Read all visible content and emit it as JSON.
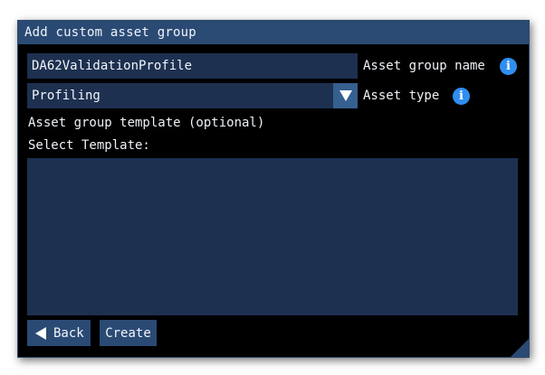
{
  "dialog": {
    "title": "Add custom asset group"
  },
  "form": {
    "name_value": "DA62ValidationProfile",
    "name_label": "Asset group name",
    "type_value": "Profiling",
    "type_label": "Asset type",
    "template_heading": "Asset group template (optional)",
    "select_template_label": "Select Template:",
    "template_items": []
  },
  "buttons": {
    "back_label": "Back",
    "create_label": "Create"
  },
  "icons": {
    "info": "info-icon",
    "dropdown": "triangle-down-icon",
    "back": "triangle-left-icon",
    "resize": "resize-grip-icon"
  },
  "colors": {
    "title_bar": "#2a4a74",
    "field_bg": "#1d3050",
    "dropdown_button": "#35608f",
    "info_icon": "#2f8ef0",
    "window_bg": "#000000"
  }
}
